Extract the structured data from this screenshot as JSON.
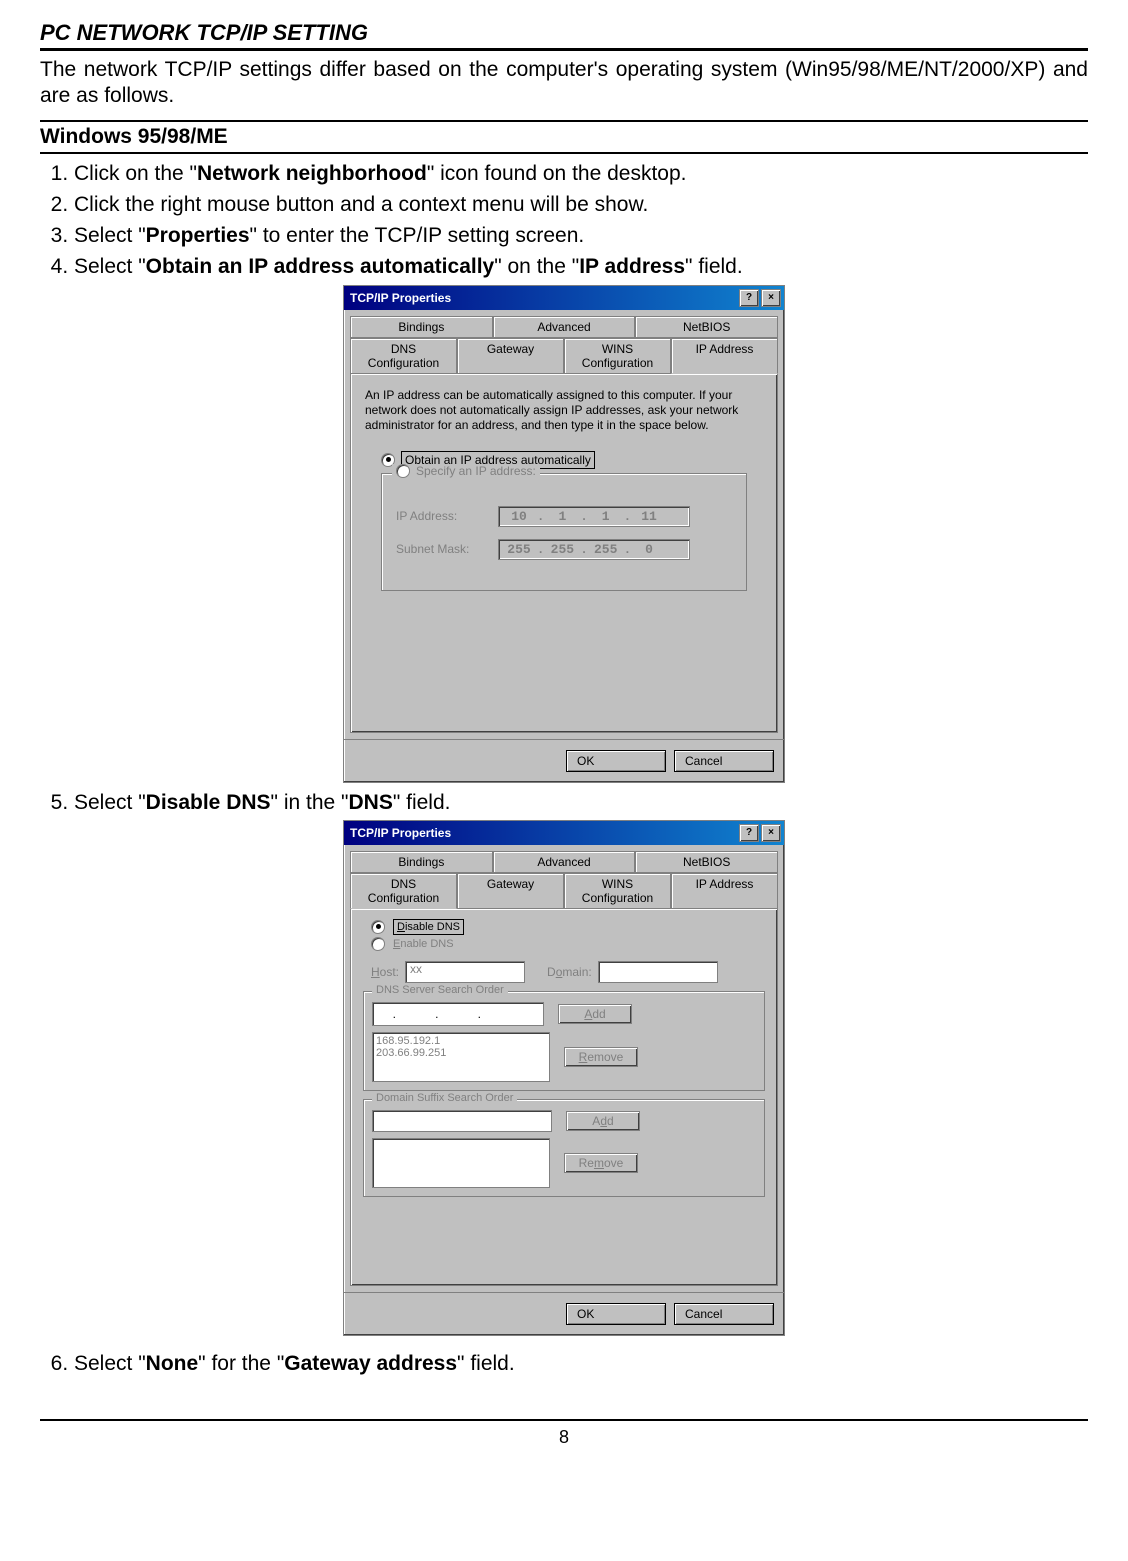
{
  "section_title": "PC NETWORK TCP/IP SETTING",
  "intro": "The network TCP/IP settings differ based on the computer's operating system (Win95/98/ME/NT/2000/XP) and are as follows.",
  "sub_title": "Windows 95/98/ME",
  "steps": {
    "s1a": "Click on the \"",
    "s1b": "Network neighborhood",
    "s1c": "\" icon found on the desktop.",
    "s2": "Click the right mouse button and a context menu will be show.",
    "s3a": "Select \"",
    "s3b": "Properties",
    "s3c": "\" to enter the TCP/IP setting screen.",
    "s4a": "Select \"",
    "s4b": "Obtain an IP address automatically",
    "s4c": "\" on the \"",
    "s4d": "IP address",
    "s4e": "\" field.",
    "s5a": "Select \"",
    "s5b": "Disable DNS",
    "s5c": "\" in the \"",
    "s5d": "DNS",
    "s5e": "\" field.",
    "s6a": "Select \"",
    "s6b": "None",
    "s6c": "\" for the \"",
    "s6d": "Gateway address",
    "s6e": "\" field."
  },
  "dialog1": {
    "title": "TCP/IP Properties",
    "help": "?",
    "close": "×",
    "tabs_back": {
      "t1": "Bindings",
      "t2": "Advanced",
      "t3": "NetBIOS"
    },
    "tabs_front": {
      "t1": "DNS Configuration",
      "t2": "Gateway",
      "t3": "WINS Configuration",
      "t4": "IP Address"
    },
    "desc": "An IP address can be automatically assigned to this computer. If your network does not automatically assign IP addresses, ask your network administrator for an address, and then type it in the space below.",
    "opt_auto": "Obtain an IP address automatically",
    "opt_spec": "Specify an IP address:",
    "lbl_ip": "IP Address:",
    "lbl_mask": "Subnet Mask:",
    "ip": {
      "a": "10",
      "b": "1",
      "c": "1",
      "d": "11"
    },
    "mask": {
      "a": "255",
      "b": "255",
      "c": "255",
      "d": "0"
    },
    "ok": "OK",
    "cancel": "Cancel"
  },
  "dialog2": {
    "title": "TCP/IP Properties",
    "help": "?",
    "close": "×",
    "tabs_back": {
      "t1": "Bindings",
      "t2": "Advanced",
      "t3": "NetBIOS"
    },
    "tabs_front": {
      "t1": "DNS Configuration",
      "t2": "Gateway",
      "t3": "WINS Configuration",
      "t4": "IP Address"
    },
    "opt_disable": "Disable DNS",
    "opt_enable": "Enable DNS",
    "lbl_host": "Host:",
    "host_val": "xx",
    "lbl_domain": "Domain:",
    "gb_dns": "DNS Server Search Order",
    "add": "Add",
    "remove": "Remove",
    "list_dns": "168.95.192.1\n203.66.99.251",
    "gb_suffix": "Domain Suffix Search Order",
    "ok": "OK",
    "cancel": "Cancel"
  },
  "page_number": "8"
}
